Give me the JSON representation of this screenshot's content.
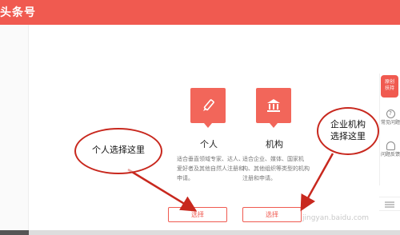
{
  "header": {
    "brand": "头条号"
  },
  "cards": [
    {
      "icon": "pencil-icon",
      "title": "个人",
      "desc": "适合垂直领域专家、达人、爱好者及其他自然人注册和申请。",
      "button": "选择"
    },
    {
      "icon": "institution-icon",
      "title": "机构",
      "desc": "适合企业、媒体、国家机构、其他组织等类型的机构注册和申请。",
      "button": "选择"
    }
  ],
  "annotations": {
    "personal": "个人选择这里",
    "org_line1": "企业机构",
    "org_line2": "选择这里"
  },
  "sidebar": {
    "badge_line1": "原创",
    "badge_line2": "扶持",
    "faq": "常见问题",
    "faq_icon": "question-icon",
    "feedback": "问题反馈",
    "feedback_icon": "headset-icon",
    "scroll_icon": "menu-icon"
  },
  "watermark": "jingyan.baidu.com",
  "colors": {
    "accent": "#f05a50",
    "annotation": "#c8281e"
  }
}
